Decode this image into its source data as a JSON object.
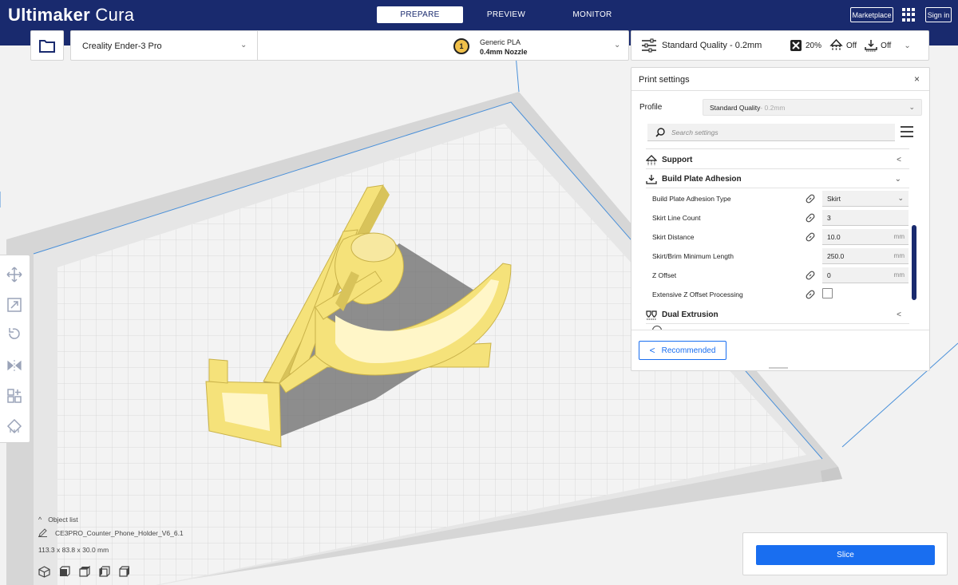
{
  "app": {
    "brand_bold": "Ultimaker",
    "brand_light": "Cura"
  },
  "stages": [
    "PREPARE",
    "PREVIEW",
    "MONITOR"
  ],
  "header": {
    "marketplace_label": "Marketplace",
    "apps_icon": "apps-grid-icon",
    "sign_in_label": "Sign in"
  },
  "machine": {
    "printer_name": "Creality Ender-3 Pro",
    "extruder_number": "1",
    "material": "Generic PLA",
    "nozzle": "0.4mm Nozzle"
  },
  "print_setup": {
    "quality": "Standard Quality - 0.2mm",
    "infill": "20%",
    "support": "Off",
    "adhesion": "Off"
  },
  "panel": {
    "title": "Print settings",
    "close_icon": "×",
    "profile_label": "Profile",
    "profile_value": "Standard Quality",
    "profile_sub": " - 0.2mm",
    "search_placeholder": "Search settings",
    "categories": {
      "support": "Support",
      "adhesion": "Build Plate Adhesion",
      "dual": "Dual Extrusion"
    },
    "settings": [
      {
        "label": "Build Plate Adhesion Type",
        "value": "Skirt",
        "unit": "",
        "linked": true,
        "type": "select"
      },
      {
        "label": "Skirt Line Count",
        "value": "3",
        "unit": "",
        "linked": true,
        "type": "text"
      },
      {
        "label": "Skirt Distance",
        "value": "10.0",
        "unit": "mm",
        "linked": true,
        "type": "text"
      },
      {
        "label": "Skirt/Brim Minimum Length",
        "value": "250.0",
        "unit": "mm",
        "linked": false,
        "type": "text"
      },
      {
        "label": "Z Offset",
        "value": "0",
        "unit": "mm",
        "linked": true,
        "type": "text"
      },
      {
        "label": "Extensive Z Offset Processing",
        "value": "",
        "unit": "",
        "linked": true,
        "type": "checkbox"
      }
    ],
    "recommended_label": "Recommended"
  },
  "object_list": {
    "title": "Object list",
    "object_name": "CE3PRO_Counter_Phone_Holder_V6_6.1",
    "dimensions": "113.3 x 83.8 x 30.0 mm"
  },
  "slice": {
    "button_label": "Slice"
  },
  "colors": {
    "header": "#192a6e",
    "accent": "#196ef0",
    "model": "#f5e27a",
    "plate": "#d9d9d9"
  }
}
